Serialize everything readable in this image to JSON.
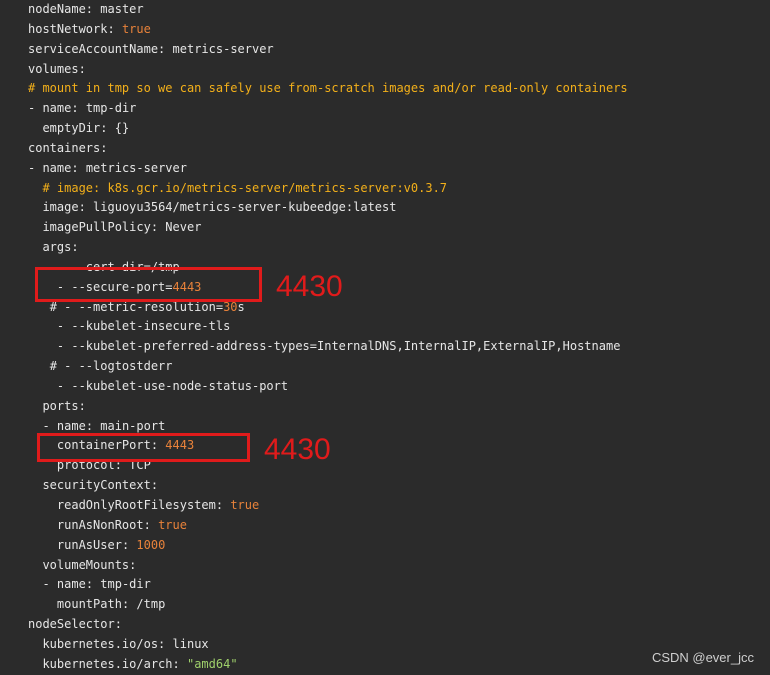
{
  "lines": [
    {
      "indent": "",
      "key": "nodeName",
      "value": "master",
      "type": "plain"
    },
    {
      "indent": "",
      "key": "hostNetwork",
      "value": "true",
      "type": "bool"
    },
    {
      "indent": "",
      "key": "serviceAccountName",
      "value": "metrics-server",
      "type": "plain"
    },
    {
      "indent": "",
      "key": "volumes",
      "value": "",
      "type": "plain"
    },
    {
      "indent": "",
      "comment": "# mount in tmp so we can safely use from-scratch images and/or read-only containers",
      "type": "comment"
    },
    {
      "indent": "",
      "dash": "- ",
      "key": "name",
      "value": "tmp-dir",
      "type": "plain"
    },
    {
      "indent": "  ",
      "key": "emptyDir",
      "value": "{}",
      "type": "plain"
    },
    {
      "indent": "",
      "key": "containers",
      "value": "",
      "type": "plain"
    },
    {
      "indent": "",
      "dash": "- ",
      "key": "name",
      "value": "metrics-server",
      "type": "plain"
    },
    {
      "indent": "  ",
      "comment": "# image: k8s.gcr.io/metrics-server/metrics-server:v0.3.7",
      "type": "comment"
    },
    {
      "indent": "  ",
      "key": "image",
      "value": "liguoyu3564/metrics-server-kubeedge:latest",
      "type": "plain"
    },
    {
      "indent": "  ",
      "key": "imagePullPolicy",
      "value": "Never",
      "type": "plain"
    },
    {
      "indent": "  ",
      "key": "args",
      "value": "",
      "type": "plain"
    },
    {
      "indent": "    ",
      "text": "- --cert-dir=/tmp",
      "type": "raw"
    },
    {
      "indent": "    ",
      "text_prefix": "- --secure-port=",
      "num": "4443",
      "type": "argnum"
    },
    {
      "indent": "   ",
      "text_prefix": "# - --metric-resolution=",
      "num": "30",
      "text_suffix": "s",
      "type": "argnum"
    },
    {
      "indent": "    ",
      "text": "- --kubelet-insecure-tls",
      "type": "raw"
    },
    {
      "indent": "    ",
      "text": "- --kubelet-preferred-address-types=InternalDNS,InternalIP,ExternalIP,Hostname",
      "type": "raw"
    },
    {
      "indent": "   ",
      "text": "# - --logtostderr",
      "type": "raw"
    },
    {
      "indent": "    ",
      "text": "- --kubelet-use-node-status-port",
      "type": "raw"
    },
    {
      "indent": "  ",
      "key": "ports",
      "value": "",
      "type": "plain"
    },
    {
      "indent": "  ",
      "dash": "- ",
      "key": "name",
      "value": "main-port",
      "type": "plain"
    },
    {
      "indent": "    ",
      "key": "containerPort",
      "value": "4443",
      "type": "num"
    },
    {
      "indent": "    ",
      "key": "protocol",
      "value": "TCP",
      "type": "plain"
    },
    {
      "indent": "  ",
      "key": "securityContext",
      "value": "",
      "type": "plain"
    },
    {
      "indent": "    ",
      "key": "readOnlyRootFilesystem",
      "value": "true",
      "type": "bool"
    },
    {
      "indent": "    ",
      "key": "runAsNonRoot",
      "value": "true",
      "type": "bool"
    },
    {
      "indent": "    ",
      "key": "runAsUser",
      "value": "1000",
      "type": "num"
    },
    {
      "indent": "  ",
      "key": "volumeMounts",
      "value": "",
      "type": "plain"
    },
    {
      "indent": "  ",
      "dash": "- ",
      "key": "name",
      "value": "tmp-dir",
      "type": "plain"
    },
    {
      "indent": "    ",
      "key": "mountPath",
      "value": "/tmp",
      "type": "plain"
    },
    {
      "indent": "",
      "key": "nodeSelector",
      "value": "",
      "type": "plain"
    },
    {
      "indent": "  ",
      "key": "kubernetes.io/os",
      "value": "linux",
      "type": "plain"
    },
    {
      "indent": "  ",
      "key": "kubernetes.io/arch",
      "value": "\"amd64\"",
      "type": "str"
    }
  ],
  "annotations": {
    "secure_port_note": "4430",
    "container_port_note": "4430"
  },
  "watermark": "CSDN @ever_jcc",
  "colors": {
    "background": "#2b2b2b",
    "text": "#e6e6e6",
    "orange": "#e8823a",
    "green": "#9fd06b",
    "comment": "#f3b01a",
    "annotation_red": "#e01b1b"
  }
}
